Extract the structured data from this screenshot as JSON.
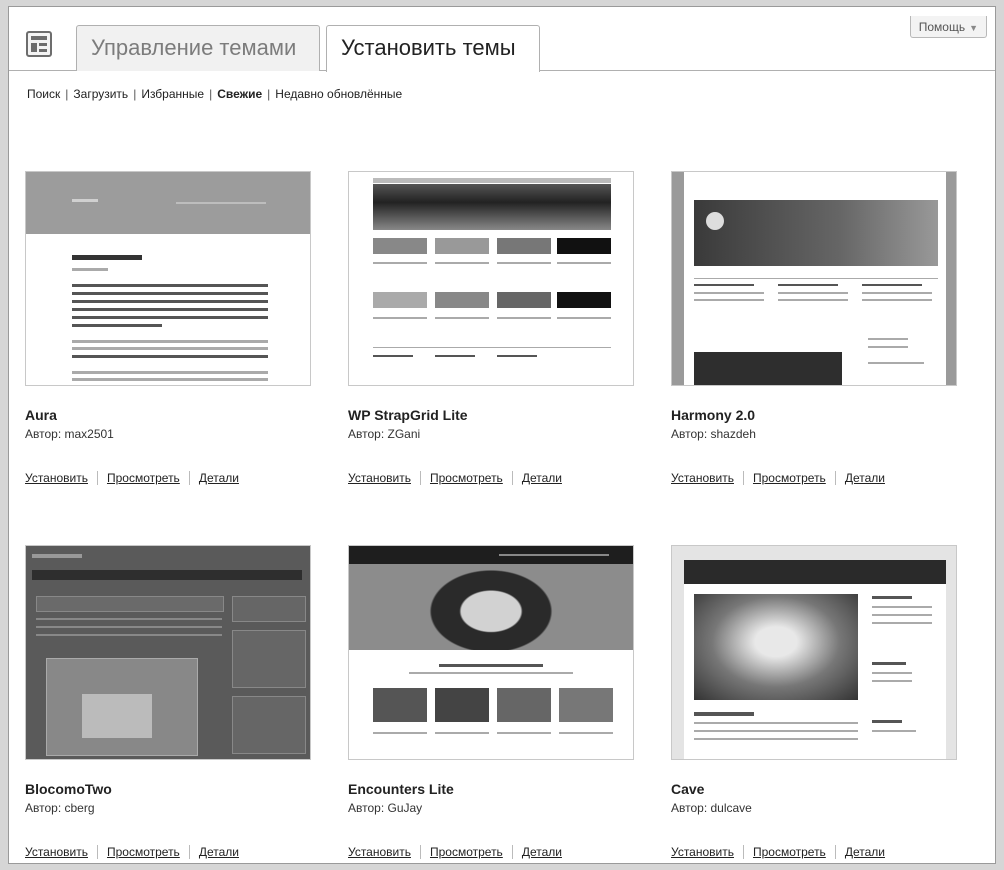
{
  "help_label": "Помощь",
  "tabs": {
    "manage": "Управление темами",
    "install": "Установить темы"
  },
  "subnav": {
    "search": "Поиск",
    "upload": "Загрузить",
    "featured": "Избранные",
    "newest": "Свежие",
    "updated": "Недавно обновлённые"
  },
  "actions": {
    "install": "Установить",
    "preview": "Просмотреть",
    "details": "Детали"
  },
  "themes": [
    {
      "name": "Aura",
      "author": "Автор: max2501"
    },
    {
      "name": "WP StrapGrid Lite",
      "author": "Автор: ZGani"
    },
    {
      "name": "Harmony 2.0",
      "author": "Автор: shazdeh"
    },
    {
      "name": "BlocomoTwo",
      "author": "Автор: cberg"
    },
    {
      "name": "Encounters Lite",
      "author": "Автор: GuJay"
    },
    {
      "name": "Cave",
      "author": "Автор: dulcave"
    }
  ]
}
